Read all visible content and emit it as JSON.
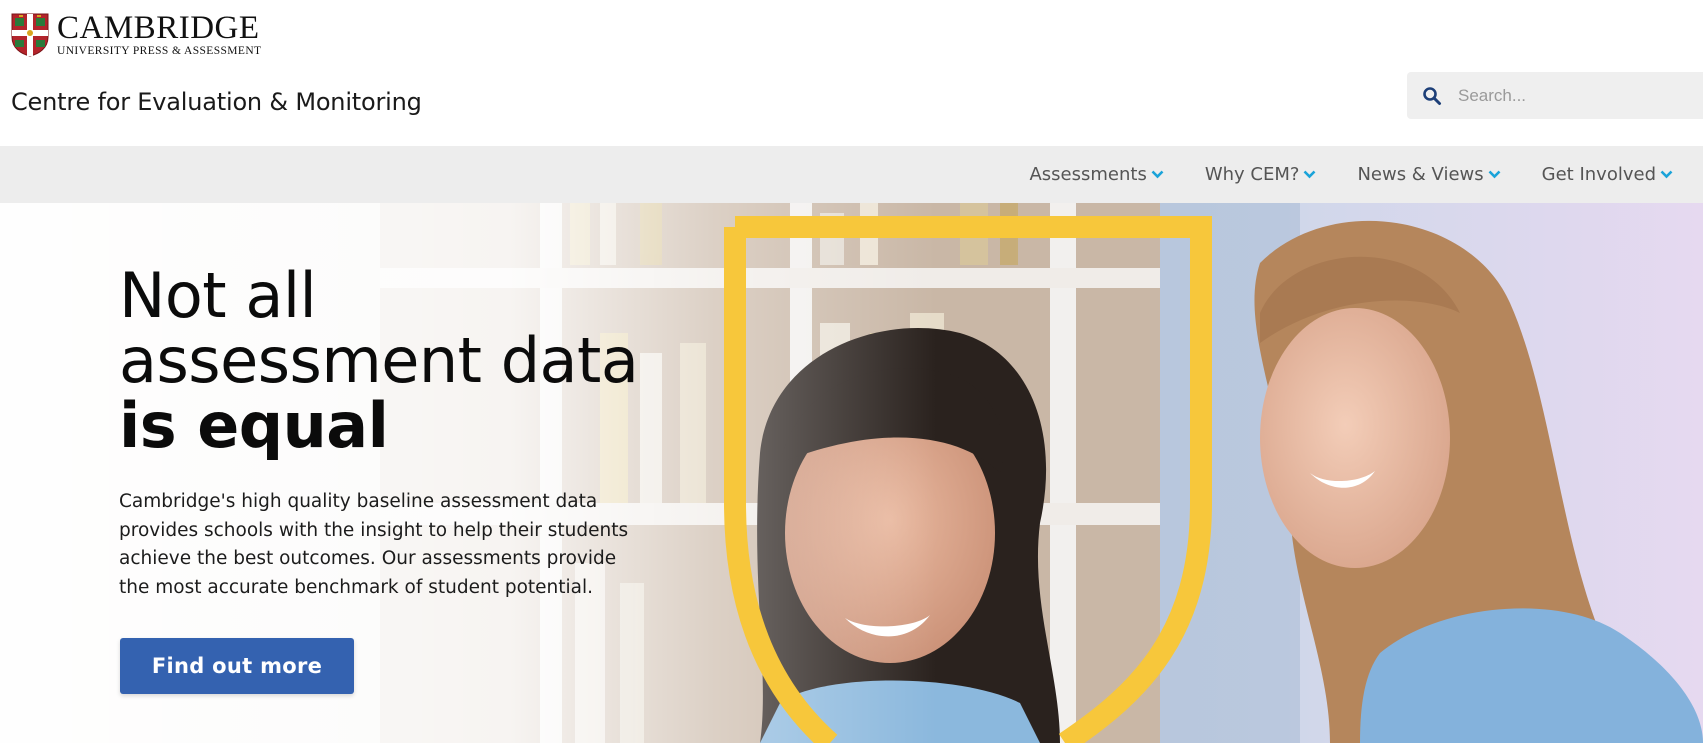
{
  "header": {
    "logo_title": "CAMBRIDGE",
    "logo_subtitle": "UNIVERSITY PRESS & ASSESSMENT",
    "site_title": "Centre for Evaluation & Monitoring",
    "search": {
      "placeholder": "Search...",
      "icon": "search-icon"
    }
  },
  "nav": {
    "items": [
      {
        "label": "Assessments",
        "icon": "chevron-down-icon"
      },
      {
        "label": "Why CEM?",
        "icon": "chevron-down-icon"
      },
      {
        "label": "News & Views",
        "icon": "chevron-down-icon"
      },
      {
        "label": "Get Involved",
        "icon": "chevron-down-icon"
      }
    ]
  },
  "hero": {
    "headline_line1": "Not all",
    "headline_line2": "assessment data",
    "headline_line3": "is equal",
    "body": "Cambridge's high quality baseline assessment data provides schools with the insight to help their students achieve the best outcomes. Our assessments provide the most accurate benchmark of student potential.",
    "cta_label": "Find out more"
  },
  "colors": {
    "accent_blue": "#3462b0",
    "chevron_blue": "#1aa3d9",
    "shield_yellow": "#f7c73b",
    "nav_bg": "#ededed",
    "shield_red": "#b3242b"
  }
}
